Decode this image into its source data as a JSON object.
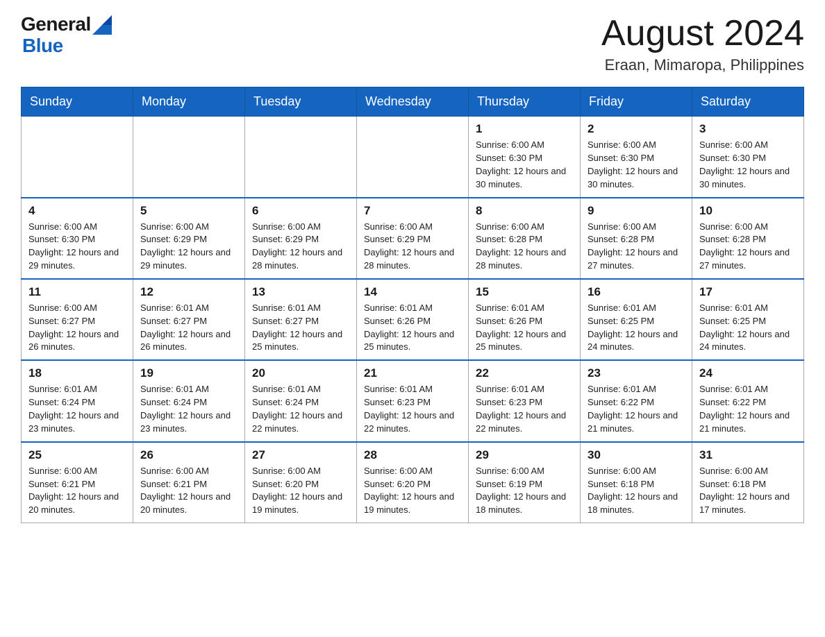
{
  "header": {
    "logo_general": "General",
    "logo_blue": "Blue",
    "month_year": "August 2024",
    "location": "Eraan, Mimaropa, Philippines"
  },
  "days_of_week": [
    "Sunday",
    "Monday",
    "Tuesday",
    "Wednesday",
    "Thursday",
    "Friday",
    "Saturday"
  ],
  "weeks": [
    [
      {
        "day": "",
        "info": ""
      },
      {
        "day": "",
        "info": ""
      },
      {
        "day": "",
        "info": ""
      },
      {
        "day": "",
        "info": ""
      },
      {
        "day": "1",
        "info": "Sunrise: 6:00 AM\nSunset: 6:30 PM\nDaylight: 12 hours and 30 minutes."
      },
      {
        "day": "2",
        "info": "Sunrise: 6:00 AM\nSunset: 6:30 PM\nDaylight: 12 hours and 30 minutes."
      },
      {
        "day": "3",
        "info": "Sunrise: 6:00 AM\nSunset: 6:30 PM\nDaylight: 12 hours and 30 minutes."
      }
    ],
    [
      {
        "day": "4",
        "info": "Sunrise: 6:00 AM\nSunset: 6:30 PM\nDaylight: 12 hours and 29 minutes."
      },
      {
        "day": "5",
        "info": "Sunrise: 6:00 AM\nSunset: 6:29 PM\nDaylight: 12 hours and 29 minutes."
      },
      {
        "day": "6",
        "info": "Sunrise: 6:00 AM\nSunset: 6:29 PM\nDaylight: 12 hours and 28 minutes."
      },
      {
        "day": "7",
        "info": "Sunrise: 6:00 AM\nSunset: 6:29 PM\nDaylight: 12 hours and 28 minutes."
      },
      {
        "day": "8",
        "info": "Sunrise: 6:00 AM\nSunset: 6:28 PM\nDaylight: 12 hours and 28 minutes."
      },
      {
        "day": "9",
        "info": "Sunrise: 6:00 AM\nSunset: 6:28 PM\nDaylight: 12 hours and 27 minutes."
      },
      {
        "day": "10",
        "info": "Sunrise: 6:00 AM\nSunset: 6:28 PM\nDaylight: 12 hours and 27 minutes."
      }
    ],
    [
      {
        "day": "11",
        "info": "Sunrise: 6:00 AM\nSunset: 6:27 PM\nDaylight: 12 hours and 26 minutes."
      },
      {
        "day": "12",
        "info": "Sunrise: 6:01 AM\nSunset: 6:27 PM\nDaylight: 12 hours and 26 minutes."
      },
      {
        "day": "13",
        "info": "Sunrise: 6:01 AM\nSunset: 6:27 PM\nDaylight: 12 hours and 25 minutes."
      },
      {
        "day": "14",
        "info": "Sunrise: 6:01 AM\nSunset: 6:26 PM\nDaylight: 12 hours and 25 minutes."
      },
      {
        "day": "15",
        "info": "Sunrise: 6:01 AM\nSunset: 6:26 PM\nDaylight: 12 hours and 25 minutes."
      },
      {
        "day": "16",
        "info": "Sunrise: 6:01 AM\nSunset: 6:25 PM\nDaylight: 12 hours and 24 minutes."
      },
      {
        "day": "17",
        "info": "Sunrise: 6:01 AM\nSunset: 6:25 PM\nDaylight: 12 hours and 24 minutes."
      }
    ],
    [
      {
        "day": "18",
        "info": "Sunrise: 6:01 AM\nSunset: 6:24 PM\nDaylight: 12 hours and 23 minutes."
      },
      {
        "day": "19",
        "info": "Sunrise: 6:01 AM\nSunset: 6:24 PM\nDaylight: 12 hours and 23 minutes."
      },
      {
        "day": "20",
        "info": "Sunrise: 6:01 AM\nSunset: 6:24 PM\nDaylight: 12 hours and 22 minutes."
      },
      {
        "day": "21",
        "info": "Sunrise: 6:01 AM\nSunset: 6:23 PM\nDaylight: 12 hours and 22 minutes."
      },
      {
        "day": "22",
        "info": "Sunrise: 6:01 AM\nSunset: 6:23 PM\nDaylight: 12 hours and 22 minutes."
      },
      {
        "day": "23",
        "info": "Sunrise: 6:01 AM\nSunset: 6:22 PM\nDaylight: 12 hours and 21 minutes."
      },
      {
        "day": "24",
        "info": "Sunrise: 6:01 AM\nSunset: 6:22 PM\nDaylight: 12 hours and 21 minutes."
      }
    ],
    [
      {
        "day": "25",
        "info": "Sunrise: 6:00 AM\nSunset: 6:21 PM\nDaylight: 12 hours and 20 minutes."
      },
      {
        "day": "26",
        "info": "Sunrise: 6:00 AM\nSunset: 6:21 PM\nDaylight: 12 hours and 20 minutes."
      },
      {
        "day": "27",
        "info": "Sunrise: 6:00 AM\nSunset: 6:20 PM\nDaylight: 12 hours and 19 minutes."
      },
      {
        "day": "28",
        "info": "Sunrise: 6:00 AM\nSunset: 6:20 PM\nDaylight: 12 hours and 19 minutes."
      },
      {
        "day": "29",
        "info": "Sunrise: 6:00 AM\nSunset: 6:19 PM\nDaylight: 12 hours and 18 minutes."
      },
      {
        "day": "30",
        "info": "Sunrise: 6:00 AM\nSunset: 6:18 PM\nDaylight: 12 hours and 18 minutes."
      },
      {
        "day": "31",
        "info": "Sunrise: 6:00 AM\nSunset: 6:18 PM\nDaylight: 12 hours and 17 minutes."
      }
    ]
  ]
}
